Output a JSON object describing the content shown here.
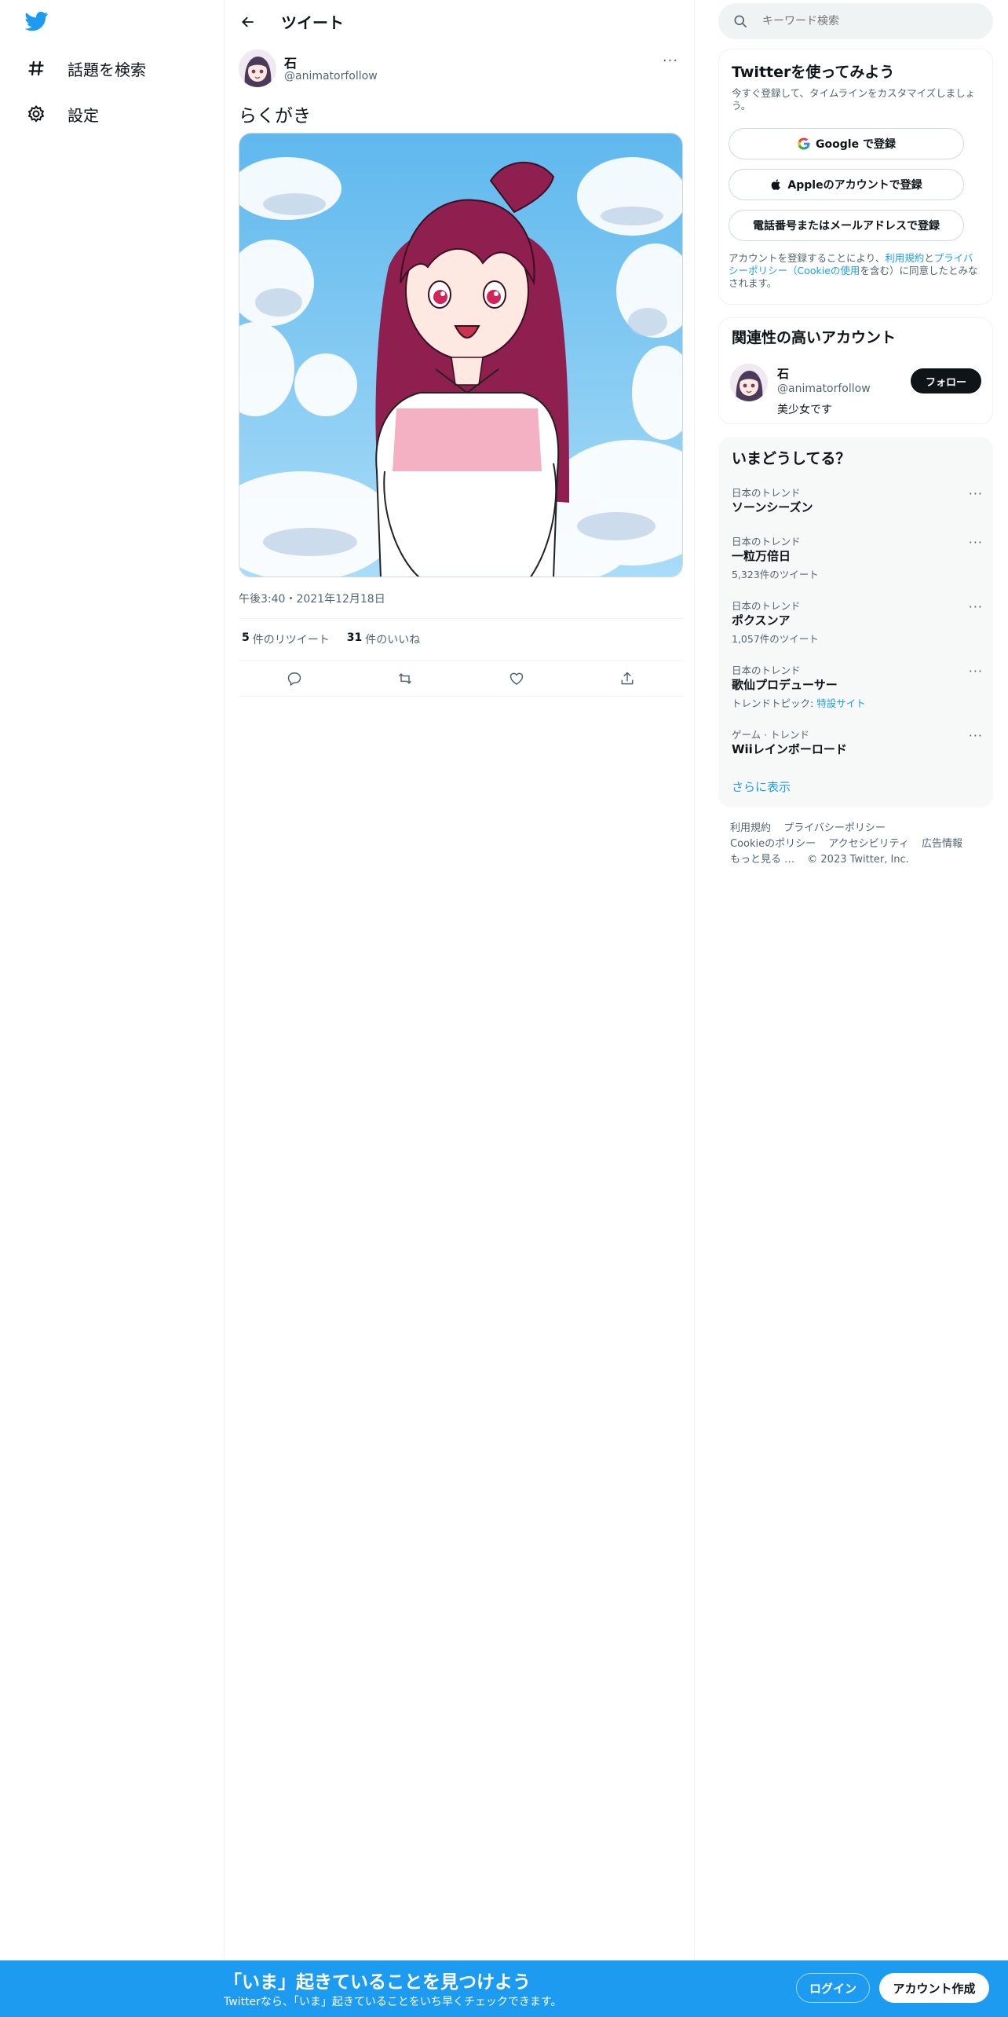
{
  "nav": {
    "logo_icon": "twitter-bird-icon",
    "items": [
      {
        "label": "話題を検索",
        "icon": "hashtag-icon"
      },
      {
        "label": "設定",
        "icon": "gear-icon"
      }
    ]
  },
  "header": {
    "title": "ツイート"
  },
  "tweet": {
    "author_name": "石",
    "author_handle": "@animatorfollow",
    "text": "らくがき",
    "timestamp": "午後3:40・2021年12月18日",
    "retweet_count": "5",
    "retweet_label": "件のリツイート",
    "like_count": "31",
    "like_label": "件のいいね"
  },
  "search": {
    "placeholder": "キーワード検索"
  },
  "signup": {
    "title": "Twitterを使ってみよう",
    "subtitle": "今すぐ登録して、タイムラインをカスタマイズしましょう。",
    "google_label": "Google で登録",
    "apple_label": "Appleのアカウントで登録",
    "phone_label": "電話番号またはメールアドレスで登録",
    "legal_prefix": "アカウントを登録することにより、",
    "legal_terms": "利用規約",
    "legal_and": "と",
    "legal_privacy": "プライバシーポリシー（Cookieの使用",
    "legal_suffix": "を含む）に同意したとみなされます。"
  },
  "related": {
    "title": "関連性の高いアカウント",
    "name": "石",
    "handle": "@animatorfollow",
    "bio": "美少女です",
    "follow_label": "フォロー"
  },
  "trends": {
    "title": "いまどうしてる？",
    "items": [
      {
        "context": "日本のトレンド",
        "name": "ソーンシーズン",
        "count": ""
      },
      {
        "context": "日本のトレンド",
        "name": "一粒万倍日",
        "count": "5,323件のツイート"
      },
      {
        "context": "日本のトレンド",
        "name": "ポクスンア",
        "count": "1,057件のツイート"
      },
      {
        "context": "日本のトレンド",
        "name": "歌仙プロデューサー",
        "count": "トレンドトピック:",
        "topic_link": "特設サイト"
      },
      {
        "context": "ゲーム · トレンド",
        "name": "Wiiレインボーロード",
        "count": ""
      }
    ],
    "show_more": "さらに表示"
  },
  "footer": {
    "line1": [
      "利用規約",
      "プライバシーポリシー"
    ],
    "line2": [
      "Cookieのポリシー",
      "アクセシビリティ",
      "広告情報"
    ],
    "line3": [
      "もっと見る …",
      "© 2023 Twitter, Inc."
    ]
  },
  "bottom_bar": {
    "title": "「いま」起きていることを見つけよう",
    "subtitle": "Twitterなら、「いま」起きていることをいち早くチェックできます。",
    "login_label": "ログイン",
    "signup_label": "アカウント作成"
  },
  "colors": {
    "accent": "#1d9bf0",
    "text": "#0f1419",
    "secondary": "#536471",
    "border": "#eff3f4"
  }
}
